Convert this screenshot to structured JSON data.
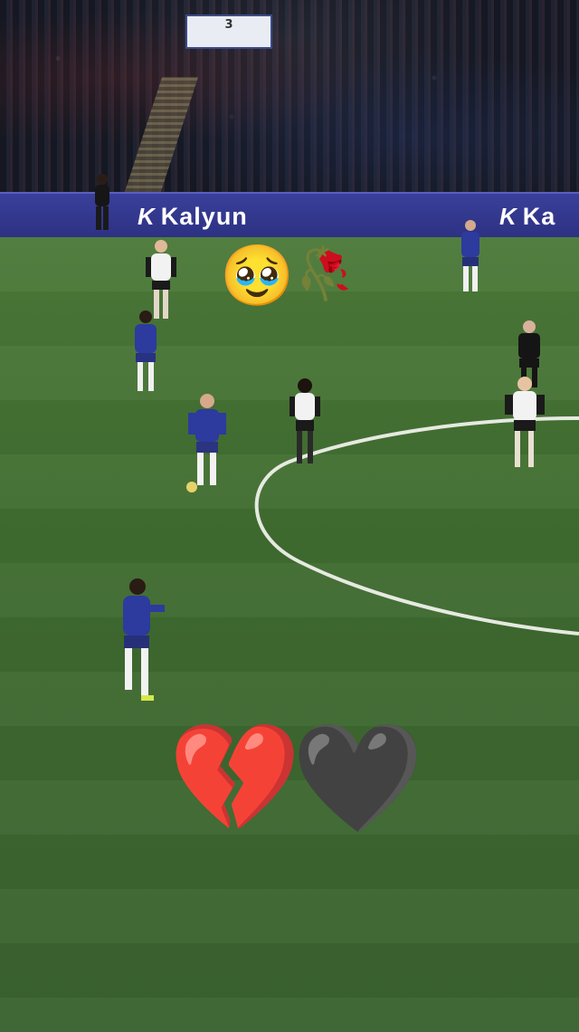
{
  "video": {
    "stand_number": "3",
    "ad_board": {
      "brand": "Kalyun",
      "brand_truncated": "Ka",
      "mark": "K"
    },
    "team_colors": {
      "home_kit": "#2d3a9e",
      "away_kit": "#f2f2f2",
      "referee": "#1a1a1a",
      "pitch": "#4a7a38",
      "ad_board": "#3338a0"
    }
  },
  "overlay": {
    "pleading_face": "🥹",
    "wilted_rose": "🥀",
    "broken_heart": "💔",
    "black_heart": "🖤"
  }
}
